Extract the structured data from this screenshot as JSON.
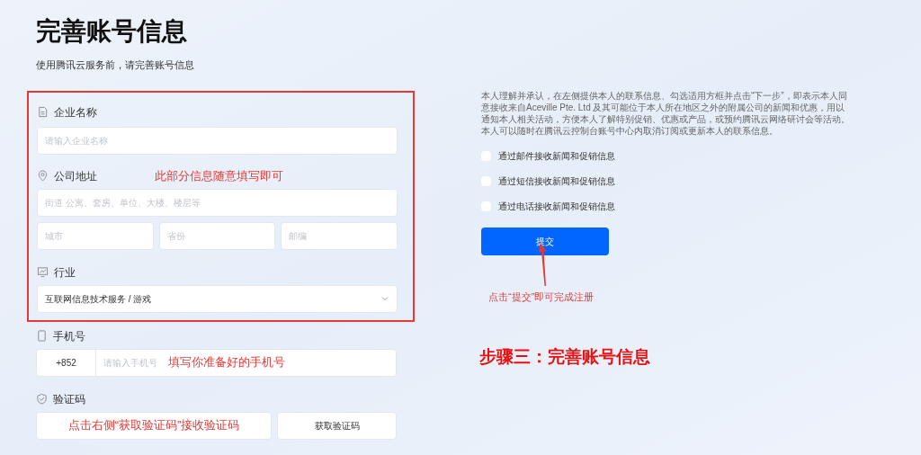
{
  "title": "完善账号信息",
  "subtitle": "使用腾讯云服务前，请完善账号信息",
  "company": {
    "label": "企业名称",
    "placeholder": "请输入企业名称"
  },
  "address": {
    "label": "公司地址",
    "note": "此部分信息随意填写即可",
    "street_placeholder": "街道 公寓、套房、单位、大楼、楼层等",
    "city_placeholder": "城市",
    "province_placeholder": "省份",
    "postcode_placeholder": "邮编"
  },
  "industry": {
    "label": "行业",
    "value": "互联网信息技术服务 / 游戏"
  },
  "phone": {
    "label": "手机号",
    "country_code": "+852",
    "placeholder": "请输入手机号",
    "note": "填写你准备好的手机号"
  },
  "code": {
    "label": "验证码",
    "note": "点击右侧“获取验证码”接收验证码",
    "button": "获取验证码"
  },
  "consent_text": "本人理解并承认，在左侧提供本人的联系信息、勾选适用方框并点击“下一步”，即表示本人同意接收来自Aceville Pte. Ltd 及其可能位于本人所在地区之外的附属公司的新闻和优惠，用以通知本人相关活动，方便本人了解特别促销、优惠或产品，或预约腾讯云网络研讨会等活动。本人可以随时在腾讯云控制台账号中心内取消订阅或更新本人的联系信息。",
  "options": [
    {
      "label": "通过邮件接收新闻和促销信息",
      "checked": false
    },
    {
      "label": "通过短信接收新闻和促销信息",
      "checked": false
    },
    {
      "label": "通过电话接收新闻和促销信息",
      "checked": false
    }
  ],
  "submit": "提交",
  "submit_note": "点击“提交”即可完成注册",
  "step_title": "步骤三：完善账号信息"
}
